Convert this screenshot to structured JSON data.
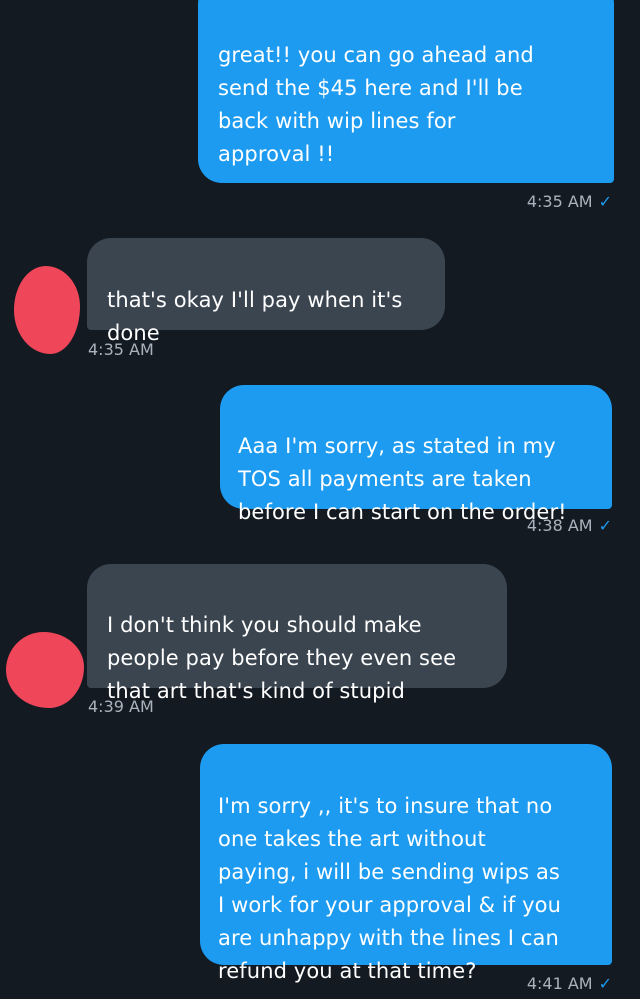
{
  "conversation": {
    "messages": [
      {
        "sender": "self",
        "text": "great!! you can go ahead and\nsend the $45 here and I'll be\nback with wip lines for\napproval !!",
        "time": "4:35 AM",
        "read_check": "✓"
      },
      {
        "sender": "other",
        "text": "that's okay I'll pay when it's\ndone",
        "time": "4:35 AM"
      },
      {
        "sender": "self",
        "text": "Aaa I'm sorry, as stated in my\nTOS all payments are taken\nbefore I can start on the order!",
        "time": "4:38 AM",
        "read_check": "✓"
      },
      {
        "sender": "other",
        "text": "I don't think you should make\npeople pay before they even see\nthat art that's kind of stupid",
        "time": "4:39 AM"
      },
      {
        "sender": "self",
        "text": "I'm sorry ,, it's to insure that no\none takes the art without\npaying, i will be sending wips as\nI work for your approval & if you\nare unhappy with the lines I can\nrefund you at that time?",
        "time": "4:41 AM",
        "read_check": "✓"
      }
    ]
  },
  "colors": {
    "background": "#141a22",
    "outgoing_bubble": "#1d9bf0",
    "incoming_bubble": "#3b4550",
    "timestamp": "#aab3bd",
    "avatar_scribble": "#f0465a"
  }
}
